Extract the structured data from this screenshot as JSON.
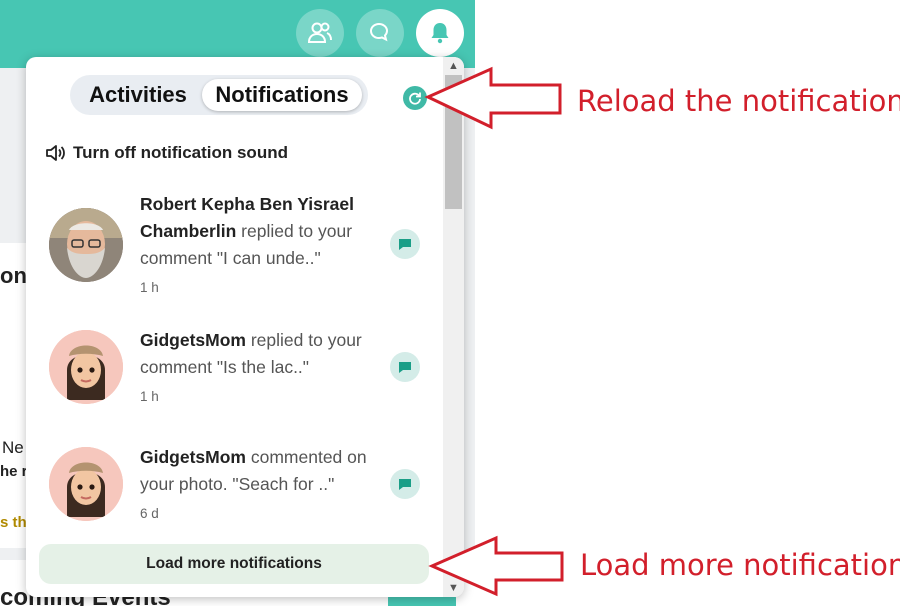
{
  "background": {
    "left_text_1": "on",
    "left_text_2": "Ne",
    "left_text_3": "he r",
    "left_text_4": "s th",
    "bottom_heading": "coming Events"
  },
  "popup": {
    "tabs": [
      {
        "label": "Activities",
        "active": false
      },
      {
        "label": "Notifications",
        "active": true
      }
    ],
    "sound_toggle": "Turn off notification sound",
    "notifications": [
      {
        "name": "Robert Kepha Ben Yisrael Chamberlin",
        "action": "replied to your comment \"I can unde..\"",
        "time": "1 h",
        "avatar": "photo-avatar"
      },
      {
        "name": "GidgetsMom",
        "action": "replied to your comment \"Is the lac..\"",
        "time": "1 h",
        "avatar": "memoji-avatar"
      },
      {
        "name": "GidgetsMom",
        "action": "commented on your photo. \"Seach for ..\"",
        "time": "6 d",
        "avatar": "memoji-avatar"
      }
    ],
    "load_more": "Load more notifications"
  },
  "annotations": {
    "reload": "Reload the notifications",
    "load_more": "Load more notifications"
  },
  "colors": {
    "brand": "#47c6b3",
    "annotation": "#d21f2b",
    "load_more_bg": "#e5f1e7"
  }
}
